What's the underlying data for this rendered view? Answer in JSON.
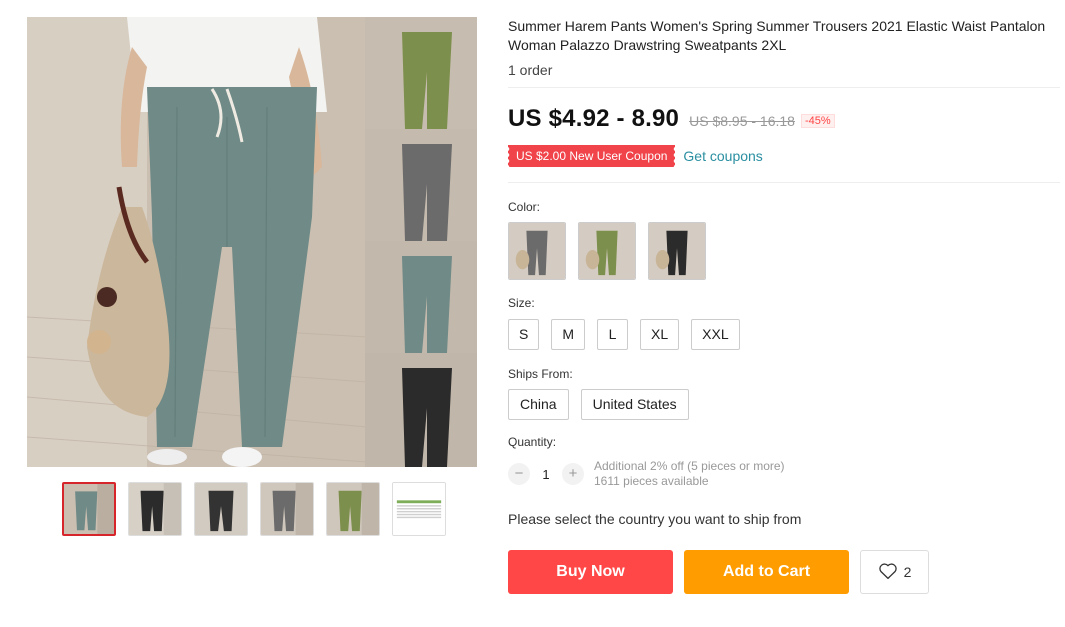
{
  "product": {
    "title": "Summer Harem Pants Women's Spring Summer Trousers 2021 Elastic Waist Pantalon Woman Palazzo Drawstring Sweatpants 2XL",
    "orders": "1 order",
    "price": "US $4.92 - 8.90",
    "original_price": "US $8.95 - 16.18",
    "discount": "-45%",
    "coupon": "US $2.00 New User Coupon",
    "get_coupons": "Get coupons"
  },
  "gallery": {
    "main_color": "#6f8a87",
    "thumbs": [
      {
        "name": "grey-teal",
        "color": "#6f8a87"
      },
      {
        "name": "black",
        "color": "#2b2b2b"
      },
      {
        "name": "black-2",
        "color": "#333333"
      },
      {
        "name": "grey",
        "color": "#6b6b6b"
      },
      {
        "name": "green",
        "color": "#7d8f4c"
      },
      {
        "name": "size-chart",
        "color": "#7fae5a"
      }
    ]
  },
  "color": {
    "label": "Color:",
    "options": [
      {
        "name": "grey",
        "color": "#6b6b6b"
      },
      {
        "name": "green",
        "color": "#7d8f4c"
      },
      {
        "name": "black",
        "color": "#2b2b2b"
      }
    ]
  },
  "size": {
    "label": "Size:",
    "options": [
      "S",
      "M",
      "L",
      "XL",
      "XXL"
    ]
  },
  "ships_from": {
    "label": "Ships From:",
    "options": [
      "China",
      "United States"
    ]
  },
  "quantity": {
    "label": "Quantity:",
    "minus": "−",
    "value": "1",
    "plus": "+",
    "offer": "Additional 2% off (5 pieces or more)",
    "available": "1611 pieces available"
  },
  "ship_note": "Please select the country you want to ship from",
  "actions": {
    "buy_now": "Buy Now",
    "add_to_cart": "Add to Cart",
    "wishlist_count": "2"
  },
  "colors": {
    "buy_now": "#ff4747",
    "add_to_cart": "#ff9c00",
    "coupon": "#f0434a",
    "selected_thumb_border": "#d7262b"
  },
  "icons": {
    "wishlist": "heart-icon"
  }
}
